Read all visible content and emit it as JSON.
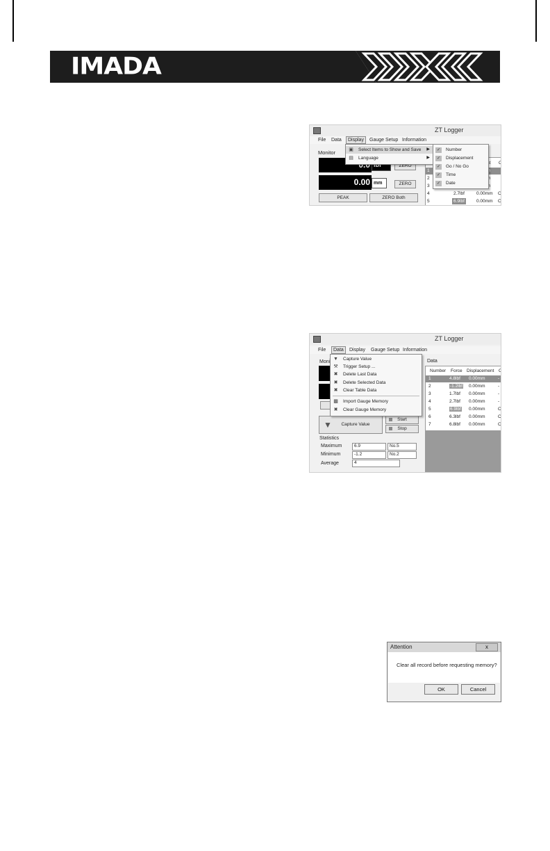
{
  "header": {
    "brand": "IMADA"
  },
  "window1": {
    "title": "ZT Logger",
    "menu": [
      "File",
      "Data",
      "Display",
      "Gauge Setup",
      "Information"
    ],
    "monitor_label": "Monitor",
    "force_value": "0.0",
    "force_unit": "lbf",
    "disp_value": "0.00",
    "disp_unit": "mm",
    "zero_label": "ZERO",
    "peak_label": "PEAK",
    "zero_both_label": "ZERO Both",
    "display_menu": [
      "Select Items to Show and Save",
      "Language"
    ],
    "submenu": [
      "Number",
      "Displacement",
      "Go / No Go",
      "Time",
      "Date"
    ],
    "table_header_fragment": [
      "nt",
      "C"
    ],
    "rows": [
      {
        "n": "1",
        "force": "",
        "disp": "m",
        "c": "-"
      },
      {
        "n": "2",
        "force": "",
        "disp": "m",
        "c": "-"
      },
      {
        "n": "3",
        "force": "",
        "disp": "m",
        "c": "-"
      },
      {
        "n": "4",
        "force": "2.7lbf",
        "disp": "0.00mm",
        "c": "O"
      },
      {
        "n": "5",
        "force": "6.9lbf",
        "disp": "0.00mm",
        "c": "O"
      }
    ]
  },
  "window2": {
    "title": "ZT Logger",
    "menu": [
      "File",
      "Data",
      "Display",
      "Gauge Setup",
      "Information"
    ],
    "monitor_label": "Moni",
    "data_menu": [
      "Capture Value",
      "Trigger Setup ...",
      "Delete Last Data",
      "Delete Selected Data",
      "Clear Table Data",
      "Import Gauge Memory",
      "Clear Gauge Memory"
    ],
    "data_label": "Data",
    "columns": [
      "Number",
      "Force",
      "Displacement",
      "C"
    ],
    "rows": [
      {
        "n": "1",
        "force": "4.8lbf",
        "disp": "0.00mm",
        "c": "-"
      },
      {
        "n": "2",
        "force": "-1.2lbf",
        "disp": "0.00mm",
        "c": "-"
      },
      {
        "n": "3",
        "force": "1.7lbf",
        "disp": "0.00mm",
        "c": "-"
      },
      {
        "n": "4",
        "force": "2.7lbf",
        "disp": "0.00mm",
        "c": "-"
      },
      {
        "n": "5",
        "force": "6.9lbf",
        "disp": "0.00mm",
        "c": "O"
      },
      {
        "n": "6",
        "force": "6.3lbf",
        "disp": "0.00mm",
        "c": "O"
      },
      {
        "n": "7",
        "force": "6.8lbf",
        "disp": "0.00mm",
        "c": "O"
      }
    ],
    "capture_label": "Capture Value",
    "start_label": "Start",
    "stop_label": "Stop",
    "statistics_label": "Statistics",
    "stats": [
      {
        "label": "Maximum",
        "value": "6.9",
        "no": "No.5"
      },
      {
        "label": "Minimum",
        "value": "-1.2",
        "no": "No.2"
      },
      {
        "label": "Average",
        "value": "4",
        "no": ""
      }
    ]
  },
  "dialog": {
    "title": "Attention",
    "close": "x",
    "message": "Clear all record before requesting memory?",
    "ok": "OK",
    "cancel": "Cancel"
  }
}
